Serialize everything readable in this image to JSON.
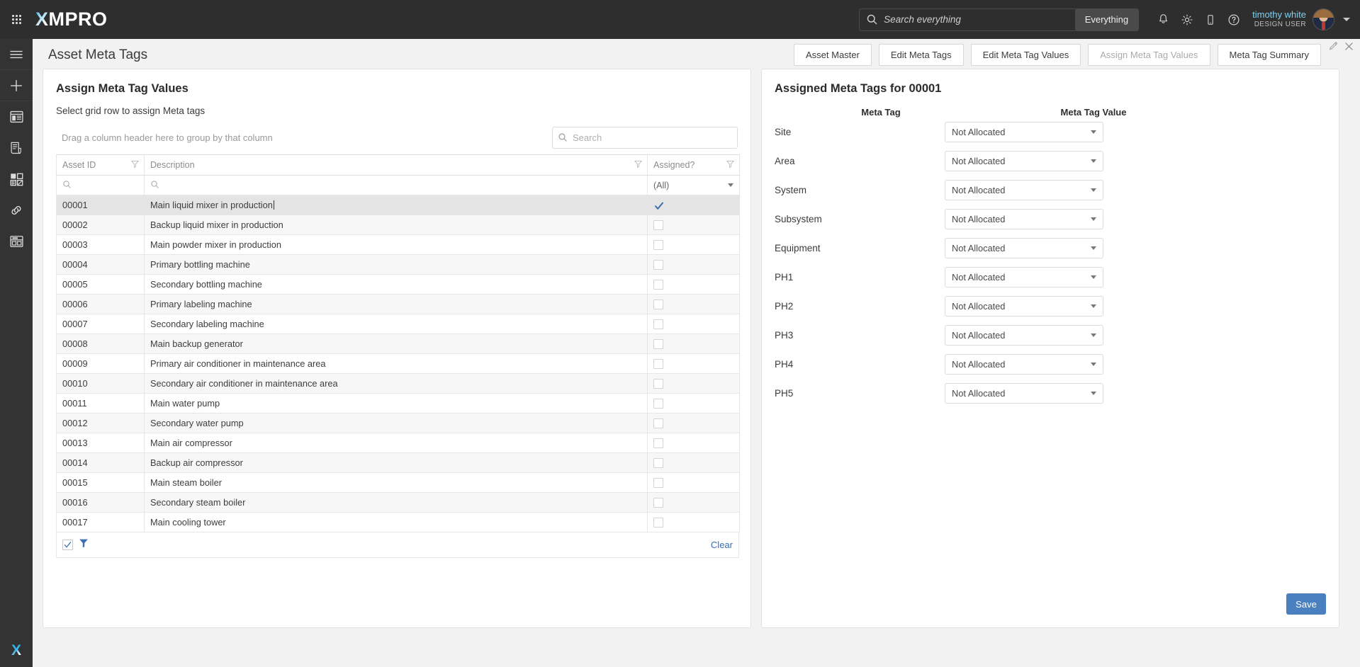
{
  "topbar": {
    "brand": "XMPRO",
    "brand_x": "X",
    "brand_rest": "MPRO",
    "search_placeholder": "Search everything",
    "search_value": "",
    "everything_label": "Everything",
    "icons": [
      "waffle-icon",
      "search-icon",
      "bell-icon",
      "gear-icon",
      "mobile-icon",
      "help-icon"
    ],
    "user": {
      "name": "timothy white",
      "role": "DESIGN USER"
    }
  },
  "sidebar": {
    "items": [
      {
        "name": "hamburger-menu-icon"
      },
      {
        "name": "add-new-icon"
      },
      {
        "name": "dashboard-icon"
      },
      {
        "name": "document-icon"
      },
      {
        "name": "app-tiles-icon"
      },
      {
        "name": "link-icon"
      },
      {
        "name": "layout-icon"
      }
    ],
    "logo": "X"
  },
  "page": {
    "title": "Asset Meta Tags",
    "tabs": [
      {
        "label": "Asset Master",
        "disabled": false
      },
      {
        "label": "Edit Meta Tags",
        "disabled": false
      },
      {
        "label": "Edit Meta Tag Values",
        "disabled": false
      },
      {
        "label": "Assign Meta Tag Values",
        "disabled": true
      },
      {
        "label": "Meta Tag Summary",
        "disabled": false
      }
    ]
  },
  "left_panel": {
    "title": "Assign Meta Tag Values",
    "subtitle": "Select grid row to assign Meta tags",
    "group_hint": "Drag a column header here to group by that column",
    "search_placeholder": "Search",
    "search_value": "",
    "columns": [
      "Asset ID",
      "Description",
      "Assigned?"
    ],
    "filter_row": {
      "asset_id": "",
      "description": "",
      "assigned": "(All)"
    },
    "rows": [
      {
        "asset_id": "00001",
        "description": "Main liquid mixer in production",
        "assigned": true,
        "selected": true
      },
      {
        "asset_id": "00002",
        "description": "Backup liquid mixer in production",
        "assigned": false,
        "selected": false
      },
      {
        "asset_id": "00003",
        "description": "Main powder mixer in production",
        "assigned": false,
        "selected": false
      },
      {
        "asset_id": "00004",
        "description": "Primary bottling machine",
        "assigned": false,
        "selected": false
      },
      {
        "asset_id": "00005",
        "description": "Secondary bottling machine",
        "assigned": false,
        "selected": false
      },
      {
        "asset_id": "00006",
        "description": "Primary labeling machine",
        "assigned": false,
        "selected": false
      },
      {
        "asset_id": "00007",
        "description": "Secondary labeling machine",
        "assigned": false,
        "selected": false
      },
      {
        "asset_id": "00008",
        "description": "Main backup generator",
        "assigned": false,
        "selected": false
      },
      {
        "asset_id": "00009",
        "description": "Primary air conditioner in maintenance area",
        "assigned": false,
        "selected": false
      },
      {
        "asset_id": "00010",
        "description": "Secondary air conditioner in maintenance area",
        "assigned": false,
        "selected": false
      },
      {
        "asset_id": "00011",
        "description": "Main water pump",
        "assigned": false,
        "selected": false
      },
      {
        "asset_id": "00012",
        "description": "Secondary water pump",
        "assigned": false,
        "selected": false
      },
      {
        "asset_id": "00013",
        "description": "Main air compressor",
        "assigned": false,
        "selected": false
      },
      {
        "asset_id": "00014",
        "description": "Backup air compressor",
        "assigned": false,
        "selected": false
      },
      {
        "asset_id": "00015",
        "description": "Main steam boiler",
        "assigned": false,
        "selected": false
      },
      {
        "asset_id": "00016",
        "description": "Secondary steam boiler",
        "assigned": false,
        "selected": false
      },
      {
        "asset_id": "00017",
        "description": "Main cooling tower",
        "assigned": false,
        "selected": false
      }
    ],
    "footer": {
      "checkbox_checked": true,
      "filter_icon": "funnel-icon",
      "clear_label": "Clear"
    }
  },
  "right_panel": {
    "title": "Assigned Meta Tags for 00001",
    "col_meta_tag": "Meta Tag",
    "col_meta_tag_value": "Meta Tag Value",
    "rows": [
      {
        "label": "Site",
        "value": "Not Allocated"
      },
      {
        "label": "Area",
        "value": "Not Allocated"
      },
      {
        "label": "System",
        "value": "Not Allocated"
      },
      {
        "label": "Subsystem",
        "value": "Not Allocated"
      },
      {
        "label": "Equipment",
        "value": "Not Allocated"
      },
      {
        "label": "PH1",
        "value": "Not Allocated"
      },
      {
        "label": "PH2",
        "value": "Not Allocated"
      },
      {
        "label": "PH3",
        "value": "Not Allocated"
      },
      {
        "label": "PH4",
        "value": "Not Allocated"
      },
      {
        "label": "PH5",
        "value": "Not Allocated"
      }
    ],
    "save_label": "Save"
  },
  "colors": {
    "topbar_bg": "#2e2e2e",
    "rail_bg": "#333333",
    "accent_blue": "#4a7fc0",
    "link_blue": "#3a6fb5",
    "brand_cyan": "#36b3e8",
    "selected_row": "#e4e4e4"
  }
}
